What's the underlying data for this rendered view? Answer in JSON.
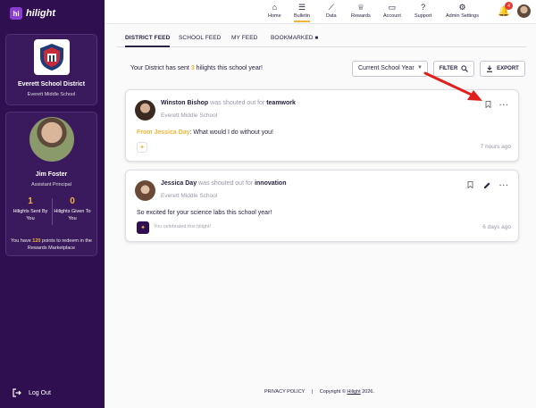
{
  "brand": {
    "name": "hilight",
    "mark": "hi"
  },
  "district": {
    "name": "Everett School District",
    "school": "Everett Middle School"
  },
  "profile": {
    "name": "Jim Foster",
    "role": "Assistant Principal",
    "sent_count": "1",
    "sent_label": "Hilights Sent By You",
    "given_count": "0",
    "given_label": "Hilights Given To You",
    "points_text_before": "You have ",
    "points_value": "120",
    "points_text_after": " points to redeem in the Rewards Marketplace"
  },
  "logout_label": "Log Out",
  "nav": {
    "items": [
      {
        "label": "Home",
        "icon": "home-icon",
        "glyph": "⌂"
      },
      {
        "label": "Bulletin",
        "icon": "list-icon",
        "glyph": "☰"
      },
      {
        "label": "Data",
        "icon": "trend-icon",
        "glyph": "⟋"
      },
      {
        "label": "Rewards",
        "icon": "trophy-icon",
        "glyph": "♕"
      },
      {
        "label": "Account",
        "icon": "account-icon",
        "glyph": "▭"
      },
      {
        "label": "Support",
        "icon": "help-icon",
        "glyph": "?"
      },
      {
        "label": "Admin Settings",
        "icon": "gear-icon",
        "glyph": "⚙"
      }
    ],
    "notification_count": "4"
  },
  "tabs": [
    "DISTRICT FEED",
    "SCHOOL FEED",
    "MY FEED",
    "BOOKMARKED"
  ],
  "summary": {
    "before": "Your District has sent ",
    "count": "3",
    "after": " hilights this school year!"
  },
  "filters": {
    "period": "Current School Year",
    "filter_label": "FILTER",
    "export_label": "EXPORT"
  },
  "posts": [
    {
      "name": "Winston Bishop",
      "connector": " was shouted out for ",
      "value": "teamwork",
      "school": "Everett Middle School",
      "from_label": "From Jessica Day",
      "message": ": What would I do without you!",
      "time": "7 hours ago"
    },
    {
      "name": "Jessica Day",
      "connector": " was shouted out for ",
      "value": "innovation",
      "school": "Everett Middle School",
      "message": "So excited for your science labs this school year!",
      "celebrated": "You celebrated this hilight!",
      "time": "6 days ago"
    }
  ],
  "footer": {
    "privacy": "PRIVACY POLICY",
    "copyright_before": "Copyright © ",
    "copyright_brand": "Hilight",
    "copyright_after": " 2026."
  },
  "colors": {
    "sidebar": "#2f0f4f",
    "accent": "#f2b53a",
    "arrow": "#e0201c"
  }
}
